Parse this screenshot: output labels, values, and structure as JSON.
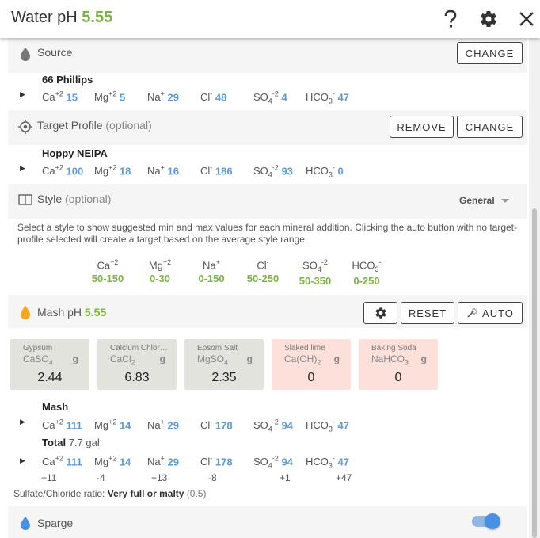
{
  "header": {
    "title": "Water pH",
    "ph_value": "5.55",
    "help_icon": "question-icon",
    "settings_icon": "gear-icon",
    "close_icon": "close-icon"
  },
  "source": {
    "label": "Source",
    "change_label": "CHANGE",
    "profile_name": "66 Phillips",
    "ions": [
      {
        "base": "Ca",
        "sup": "+2",
        "sub": "",
        "value": "15"
      },
      {
        "base": "Mg",
        "sup": "+2",
        "sub": "",
        "value": "5"
      },
      {
        "base": "Na",
        "sup": "+",
        "sub": "",
        "value": "29"
      },
      {
        "base": "Cl",
        "sup": "-",
        "sub": "",
        "value": "48"
      },
      {
        "base": "SO",
        "sup": "-2",
        "sub": "4",
        "value": "4"
      },
      {
        "base": "HCO",
        "sup": "-",
        "sub": "3",
        "value": "47"
      }
    ]
  },
  "target_profile": {
    "label": "Target Profile",
    "optional": "(optional)",
    "remove_label": "REMOVE",
    "change_label": "CHANGE",
    "profile_name": "Hoppy NEIPA",
    "ions": [
      {
        "base": "Ca",
        "sup": "+2",
        "sub": "",
        "value": "100"
      },
      {
        "base": "Mg",
        "sup": "+2",
        "sub": "",
        "value": "18"
      },
      {
        "base": "Na",
        "sup": "+",
        "sub": "",
        "value": "16"
      },
      {
        "base": "Cl",
        "sup": "-",
        "sub": "",
        "value": "186"
      },
      {
        "base": "SO",
        "sup": "-2",
        "sub": "4",
        "value": "93"
      },
      {
        "base": "HCO",
        "sup": "-",
        "sub": "3",
        "value": "0"
      }
    ]
  },
  "style": {
    "label": "Style",
    "optional": "(optional)",
    "selected": "General",
    "description": "Select a style to show suggested min and max values for each mineral addition. Clicking the auto button with no target-profile selected will create a target based on the average style range.",
    "targets": [
      {
        "base": "Ca",
        "sup": "+2",
        "sub": "",
        "range": "50-150"
      },
      {
        "base": "Mg",
        "sup": "+2",
        "sub": "",
        "range": "0-30"
      },
      {
        "base": "Na",
        "sup": "+",
        "sub": "",
        "range": "0-150"
      },
      {
        "base": "Cl",
        "sup": "-",
        "sub": "",
        "range": "50-250"
      },
      {
        "base": "SO",
        "sup": "-2",
        "sub": "4",
        "range": "50-350"
      },
      {
        "base": "HCO",
        "sup": "-",
        "sub": "3",
        "range": "0-250"
      }
    ]
  },
  "mash_ph": {
    "label": "Mash pH",
    "value": "5.55",
    "reset_label": "RESET",
    "auto_label": "AUTO",
    "settings_icon": "gear-icon",
    "wand_icon": "magic-wand-icon"
  },
  "additions": [
    {
      "name": "Gypsum",
      "formula_base": "CaSO",
      "formula_sub": "4",
      "formula_tail": "",
      "unit": "g",
      "amount": "2.44",
      "color": "#e3e3de"
    },
    {
      "name": "Calcium Chlor…",
      "formula_base": "CaCl",
      "formula_sub": "2",
      "formula_tail": "",
      "unit": "g",
      "amount": "6.83",
      "color": "#e3e3de"
    },
    {
      "name": "Epsom Salt",
      "formula_base": "MgSO",
      "formula_sub": "4",
      "formula_tail": "",
      "unit": "g",
      "amount": "2.35",
      "color": "#e3e3de"
    },
    {
      "name": "Slaked lime",
      "formula_base": "Ca(OH)",
      "formula_sub": "2",
      "formula_tail": "",
      "unit": "g",
      "amount": "0",
      "color": "#fde0da"
    },
    {
      "name": "Baking Soda",
      "formula_base": "NaHCO",
      "formula_sub": "3",
      "formula_tail": "",
      "unit": "g",
      "amount": "0",
      "color": "#fde0da"
    }
  ],
  "mash": {
    "label": "Mash",
    "ions": [
      {
        "base": "Ca",
        "sup": "+2",
        "sub": "",
        "value": "111"
      },
      {
        "base": "Mg",
        "sup": "+2",
        "sub": "",
        "value": "14"
      },
      {
        "base": "Na",
        "sup": "+",
        "sub": "",
        "value": "29"
      },
      {
        "base": "Cl",
        "sup": "-",
        "sub": "",
        "value": "178"
      },
      {
        "base": "SO",
        "sup": "-2",
        "sub": "4",
        "value": "94"
      },
      {
        "base": "HCO",
        "sup": "-",
        "sub": "3",
        "value": "47"
      }
    ]
  },
  "total": {
    "label": "Total",
    "volume": "7.7 gal",
    "ions": [
      {
        "base": "Ca",
        "sup": "+2",
        "sub": "",
        "value": "111",
        "delta": "+11"
      },
      {
        "base": "Mg",
        "sup": "+2",
        "sub": "",
        "value": "14",
        "delta": "-4"
      },
      {
        "base": "Na",
        "sup": "+",
        "sub": "",
        "value": "29",
        "delta": "+13"
      },
      {
        "base": "Cl",
        "sup": "-",
        "sub": "",
        "value": "178",
        "delta": "-8"
      },
      {
        "base": "SO",
        "sup": "-2",
        "sub": "4",
        "value": "94",
        "delta": "+1"
      },
      {
        "base": "HCO",
        "sup": "-",
        "sub": "3",
        "value": "47",
        "delta": "+47"
      }
    ]
  },
  "ratio": {
    "label": "Sulfate/Chloride ratio:",
    "text": "Very full or malty",
    "value": "(0.5)"
  },
  "sparge": {
    "label": "Sparge",
    "enabled": true
  },
  "colors": {
    "accent_green": "#7cb342",
    "ion_blue": "#5b9bd5",
    "mash_orange": "#f5a623",
    "sparge_blue": "#4a90e2"
  }
}
